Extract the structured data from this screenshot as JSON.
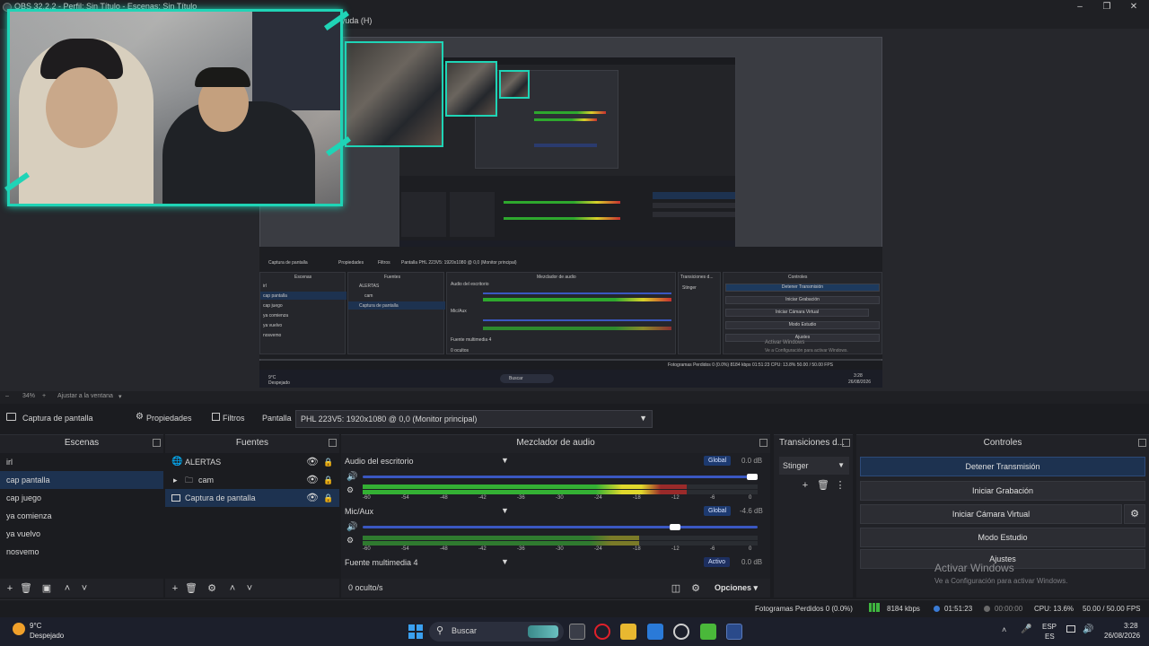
{
  "window": {
    "title": "OBS 32.2.2 - Perfil: Sin Título - Escenas: Sin Título",
    "help_menu": "Ayuda (H)"
  },
  "preview": {
    "zoom": "34%",
    "fit_label": "Ajustar a la ventana",
    "inner": {
      "source_label": "Captura de pantalla",
      "properties": "Propiedades",
      "filters": "Filtros",
      "monitor": "Pantalla   PHL 223V5: 1920x1080 @ 0,0 (Monitor principal)",
      "scenes_title": "Escenas",
      "sources_title": "Fuentes",
      "mixer_title": "Mezclador de audio",
      "transitions_title": "Transiciones d...",
      "controls_title": "Controles",
      "scenes": [
        "irl",
        "cap pantalla",
        "cap juego",
        "ya comienza",
        "ya vuelvo",
        "nosvemo"
      ],
      "sources": [
        "ALERTAS",
        "cam",
        "Captura de pantalla"
      ],
      "mix_rows": [
        "Audio del escritorio",
        "Mic/Aux",
        "Fuente multimedia 4"
      ],
      "hidden": "0 ocultos",
      "stinger": "Stinger",
      "buttons": [
        "Detener Transmisión",
        "Iniciar Grabación",
        "Iniciar Cámara Virtual",
        "Modo Estudio",
        "Ajustes"
      ],
      "wm_title": "Activar Windows",
      "wm_sub": "Ve a Configuración para activar Windows.",
      "status": "Fotogramas Perdidos 0 (0.0%)   8184 kbps   01:51:23   CPU: 13.8%   50.00 / 50.00 FPS",
      "weather_temp": "9°C",
      "weather_desc": "Despejado",
      "search": "Buscar",
      "time": "3:28",
      "date": "26/08/2026"
    }
  },
  "source_toolbar": {
    "source_name": "Captura de pantalla",
    "properties_label": "Propiedades",
    "filters_label": "Filtros",
    "display_label": "Pantalla",
    "display_value": "PHL 223V5: 1920x1080 @ 0,0 (Monitor principal)"
  },
  "scenes": {
    "title": "Escenas",
    "items": [
      "irl",
      "cap pantalla",
      "cap juego",
      "ya comienza",
      "ya vuelvo",
      "nosvemo"
    ],
    "selected_index": 1
  },
  "sources": {
    "title": "Fuentes",
    "items": [
      {
        "name": "ALERTAS",
        "icon": "globe-icon"
      },
      {
        "name": "cam",
        "icon": "folder-icon"
      },
      {
        "name": "Captura de pantalla",
        "icon": "monitor-icon"
      }
    ],
    "selected_index": 2
  },
  "mixer": {
    "title": "Mezclador de audio",
    "channels": [
      {
        "name": "Audio del escritorio",
        "badge": "Global",
        "db": "0.0 dB",
        "volume": 1.0,
        "level": 0.82
      },
      {
        "name": "Mic/Aux",
        "badge": "Global",
        "db": "-4.6 dB",
        "volume": 0.8,
        "level": 0.7
      },
      {
        "name": "Fuente multimedia 4",
        "badge": "Activo",
        "db": "0.0 dB"
      }
    ],
    "ticks": [
      "-60",
      "-54",
      "-48",
      "-42",
      "-36",
      "-30",
      "-24",
      "-18",
      "-12",
      "-6",
      "0"
    ],
    "hidden_label": "0 oculto/s",
    "options_label": "Opciones"
  },
  "transitions": {
    "title": "Transiciones d...",
    "selected": "Stinger"
  },
  "controls": {
    "title": "Controles",
    "stop_stream": "Detener Transmisión",
    "start_recording": "Iniciar Grabación",
    "virtual_cam": "Iniciar Cámara Virtual",
    "studio_mode": "Modo Estudio",
    "settings": "Ajustes"
  },
  "watermark": {
    "title": "Activar Windows",
    "subtitle": "Ve a Configuración para activar Windows."
  },
  "status": {
    "dropped": "Fotogramas Perdidos 0 (0.0%)",
    "bitrate": "8184 kbps",
    "stream_time": "01:51:23",
    "rec_time": "00:00:00",
    "cpu": "CPU: 13.6%",
    "fps": "50.00 / 50.00 FPS"
  },
  "taskbar": {
    "weather_temp": "9°C",
    "weather_desc": "Despejado",
    "search_label": "Buscar",
    "lang_top": "ESP",
    "lang_bottom": "ES",
    "time": "3:28",
    "date": "26/08/2026"
  },
  "colors": {
    "accent_teal": "#1fd4b6",
    "selected_blue": "#1d3250",
    "badge_blue": "#1d3a70"
  }
}
